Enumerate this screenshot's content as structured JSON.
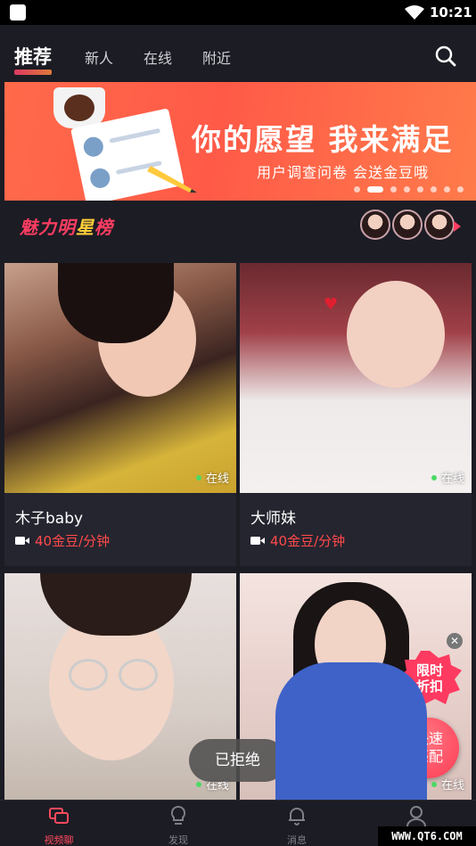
{
  "status_bar": {
    "time": "10:21"
  },
  "tabs": [
    {
      "label": "推荐",
      "active": true
    },
    {
      "label": "新人",
      "active": false
    },
    {
      "label": "在线",
      "active": false
    },
    {
      "label": "附近",
      "active": false
    }
  ],
  "banner": {
    "headline": "你的愿望  我来满足",
    "subtitle": "用户调查问卷   会送金豆哦",
    "page_count": 8,
    "active_page": 2
  },
  "rank": {
    "title_red": "魅力明",
    "title_gold": "星",
    "title_end": "榜"
  },
  "cards": [
    {
      "name": "木子baby",
      "price": "40金豆/分钟",
      "status": "在线"
    },
    {
      "name": "大师妹",
      "price": "40金豆/分钟",
      "status": "在线"
    },
    {
      "name": "",
      "price": "",
      "status": "在线"
    },
    {
      "name": "",
      "price": "",
      "status": "在线"
    }
  ],
  "toast": "已拒绝",
  "promo_badge": {
    "line1": "限时",
    "line2": "折扣"
  },
  "quick_match": {
    "line1": "快速",
    "line2": "匹配"
  },
  "bottom_nav": [
    {
      "label": "视频聊",
      "icon": "video-chat-icon",
      "active": true
    },
    {
      "label": "发现",
      "icon": "bulb-icon",
      "active": false
    },
    {
      "label": "消息",
      "icon": "bell-icon",
      "active": false
    },
    {
      "label": "",
      "icon": "profile-icon",
      "active": false
    }
  ],
  "watermark": "WWW.QT6.COM",
  "colors": {
    "accent": "#ff4a5e",
    "background": "#1c1c24",
    "card": "#252530",
    "online": "#4cd964",
    "price": "#ff4a4a"
  }
}
